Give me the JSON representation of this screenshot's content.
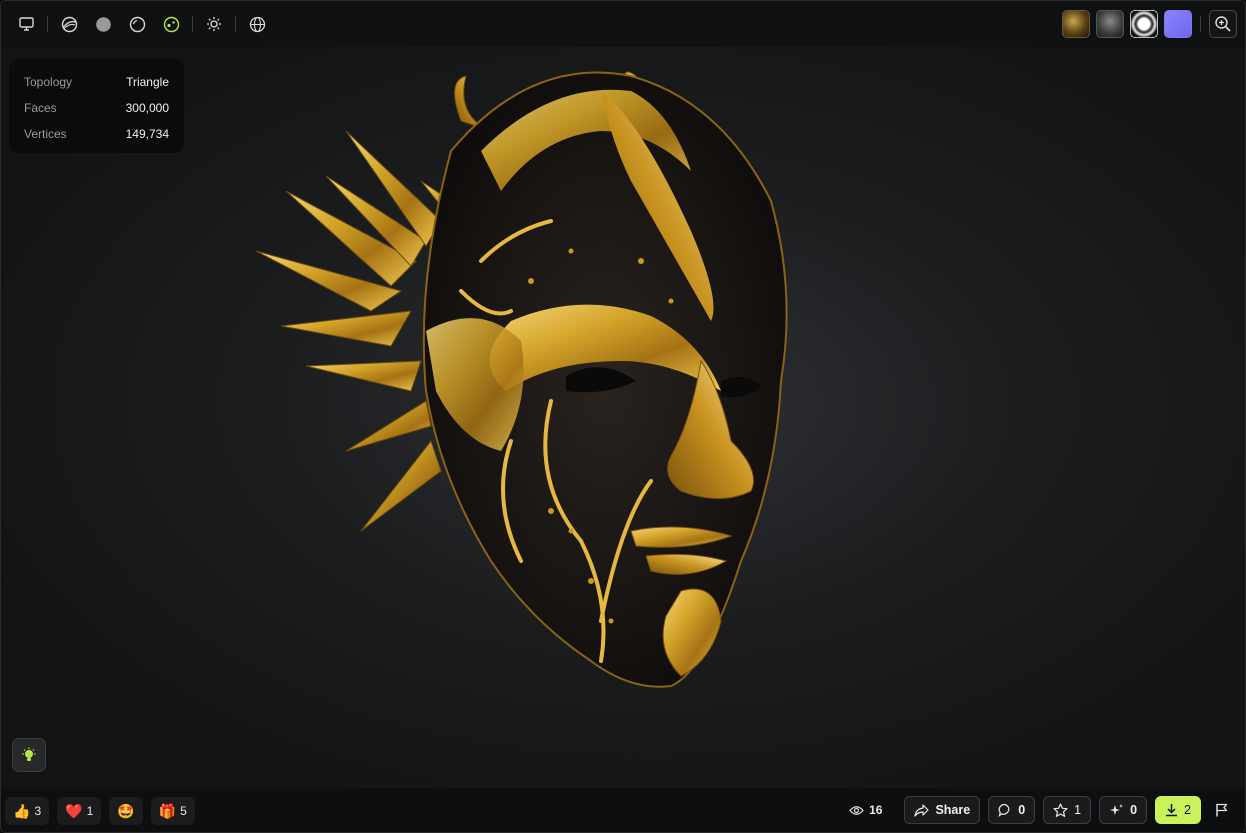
{
  "toolbar": {
    "left_icons": [
      "monitor-icon",
      "shading-icon",
      "solid-sphere-icon",
      "outline-sphere-icon",
      "matcap-icon",
      "light-icon",
      "globe-icon"
    ],
    "active_color": "#b7e84a"
  },
  "info": {
    "topology_label": "Topology",
    "topology_value": "Triangle",
    "faces_label": "Faces",
    "faces_value": "300,000",
    "vertices_label": "Vertices",
    "vertices_value": "149,734"
  },
  "reactions": [
    {
      "icon": "👍",
      "count": "3"
    },
    {
      "icon": "❤️",
      "count": "1"
    },
    {
      "icon": "🤩",
      "count": ""
    },
    {
      "icon": "🎁",
      "count": "5"
    }
  ],
  "stats": {
    "views": "16",
    "share_label": "Share",
    "comments": "0",
    "stars": "1",
    "remixes": "0",
    "downloads": "2"
  },
  "colors": {
    "accent": "#c9f25a",
    "gold": "#d4a62a"
  }
}
